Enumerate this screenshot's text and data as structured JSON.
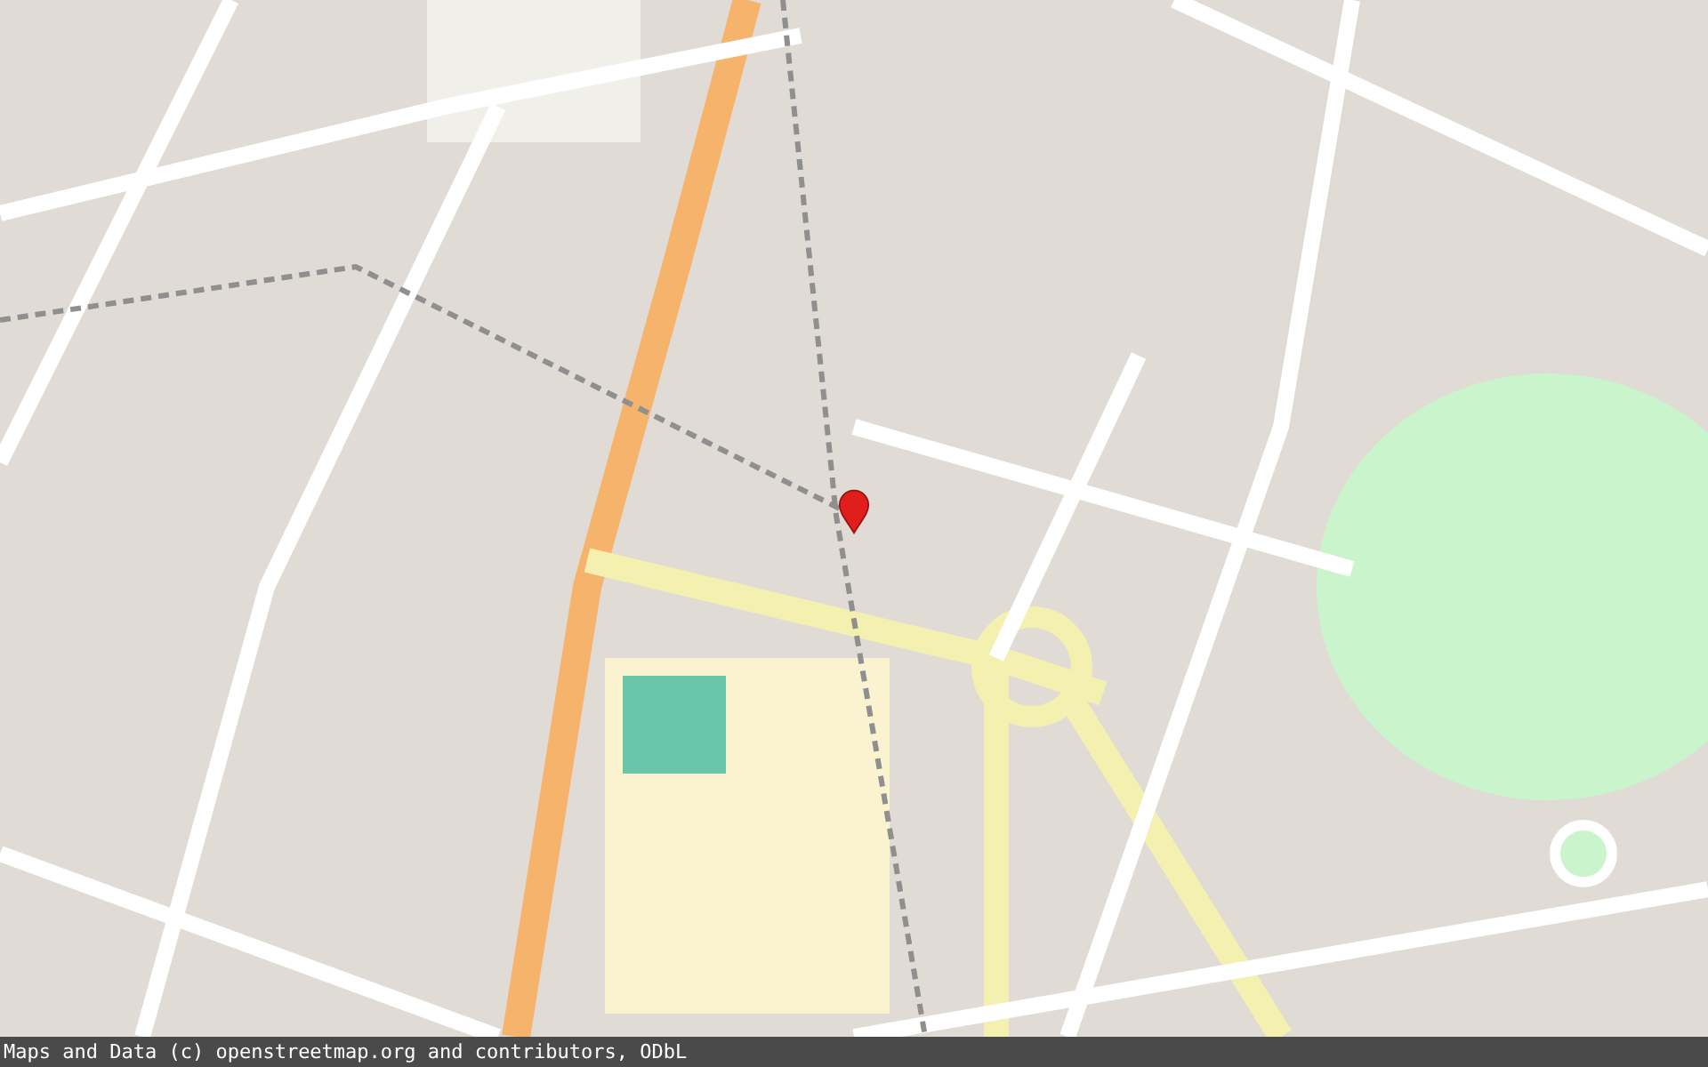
{
  "attribution": "Maps and Data (c) openstreetmap.org and contributors, ODbL"
}
